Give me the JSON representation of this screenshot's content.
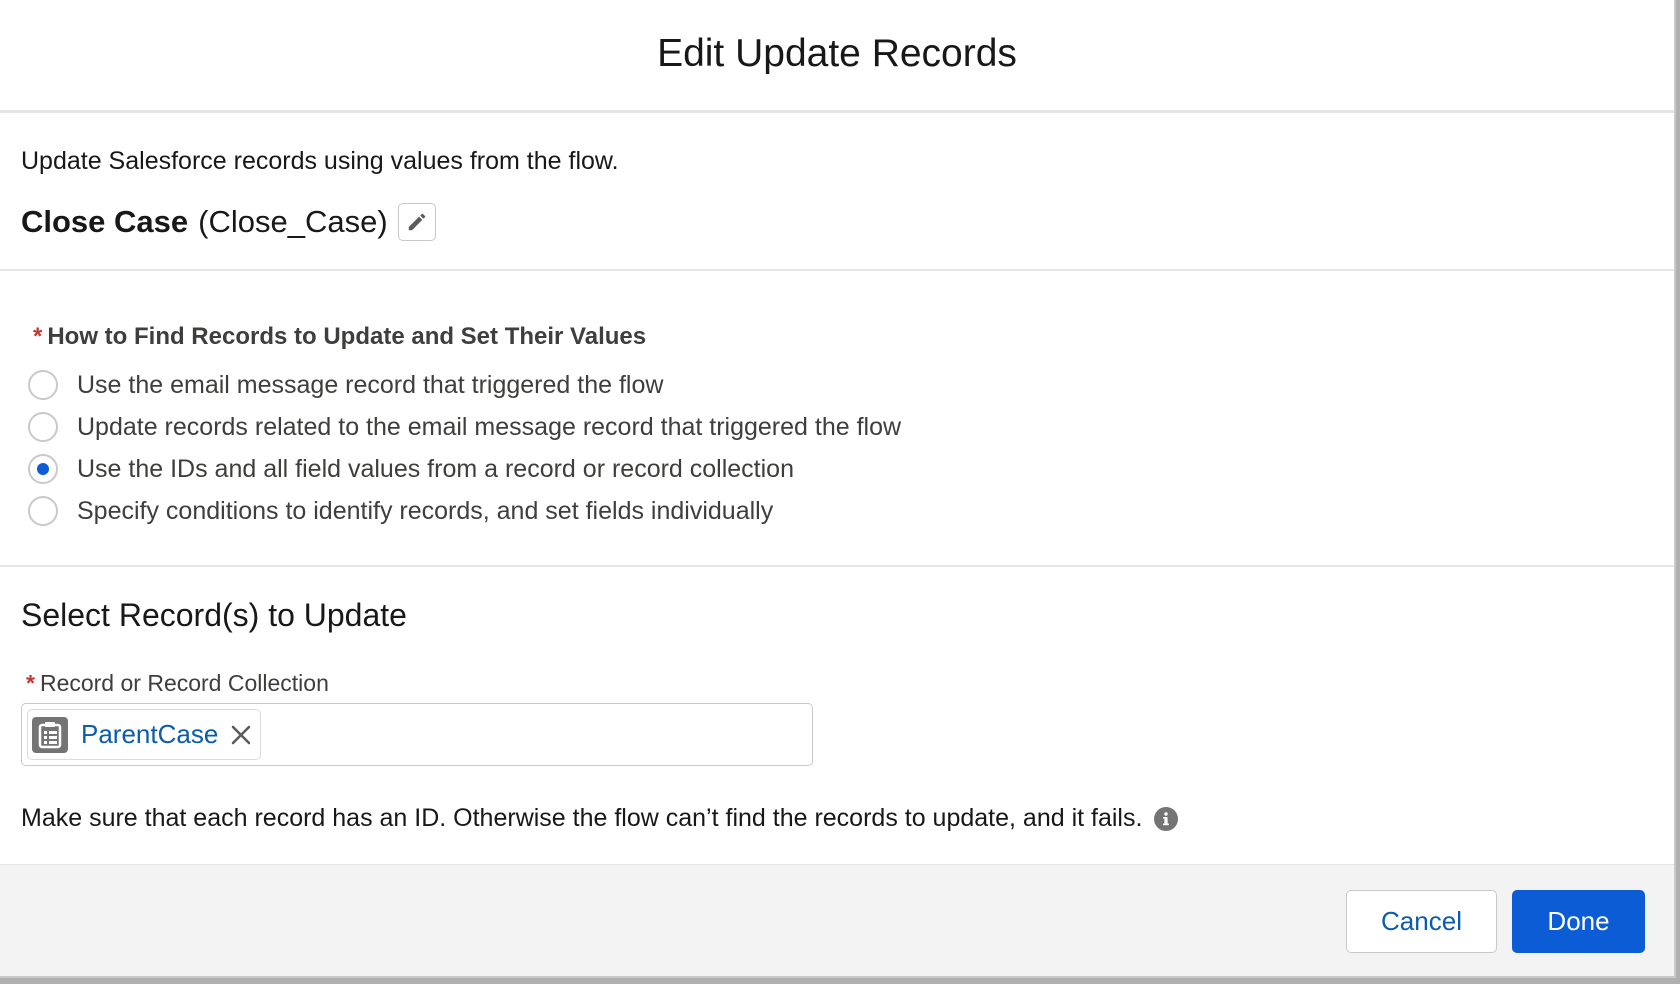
{
  "modal": {
    "title": "Edit Update Records"
  },
  "description": {
    "text": "Update Salesforce records using values from the flow.",
    "element_label": "Close Case",
    "element_api_name": "(Close_Case)"
  },
  "find_records": {
    "required_marker": "*",
    "label": "How to Find Records to Update and Set Their Values",
    "options": [
      {
        "label": "Use the email message record that triggered the flow",
        "checked": false
      },
      {
        "label": "Update records related to the email message record that triggered the flow",
        "checked": false
      },
      {
        "label": "Use the IDs and all field values from a record or record collection",
        "checked": true
      },
      {
        "label": "Specify conditions to identify records, and set fields individually",
        "checked": false
      }
    ]
  },
  "select_records": {
    "heading": "Select Record(s) to Update",
    "required_marker": "*",
    "field_label": "Record or Record Collection",
    "pill_value": "ParentCase",
    "pill_icon": "record-list-icon",
    "note": "Make sure that each record has an ID. Otherwise the flow can’t find the records to update, and it fails."
  },
  "footer": {
    "cancel_label": "Cancel",
    "done_label": "Done"
  },
  "colors": {
    "accent": "#0b5cd5",
    "link": "#0b5cab",
    "required": "#c23934",
    "footer_bg": "#f3f3f3"
  }
}
